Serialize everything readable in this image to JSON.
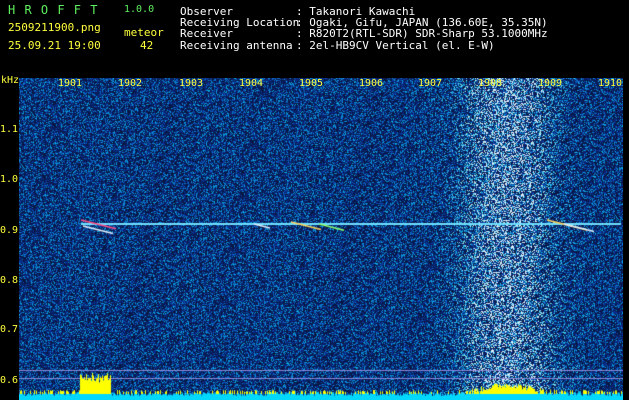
{
  "header": {
    "app_name": "H R O F F T",
    "version": "1.0.0",
    "filename": "2509211900.png",
    "datetime": "25.09.21 19:00",
    "meteor_label": "meteor",
    "meteor_count": "42",
    "info": [
      {
        "key": "Observer",
        "value": ": Takanori Kawachi"
      },
      {
        "key": "Receiving Location",
        "value": ": Ogaki, Gifu, JAPAN (136.60E, 35.35N)"
      },
      {
        "key": "Receiver",
        "value": ": R820T2(RTL-SDR) SDR-Sharp 53.1000MHz"
      },
      {
        "key": "Receiving antenna",
        "value": ": 2el-HB9CV Vertical (el. E-W)"
      }
    ]
  },
  "axes": {
    "y_unit": "kHz",
    "y_ticks": [
      "1.1",
      "1.0",
      "0.9",
      "0.8",
      "0.7",
      "0.6"
    ],
    "x_ticks": [
      "1901",
      "1902",
      "1903",
      "1904",
      "1905",
      "1906",
      "1907",
      "1908",
      "1909",
      "1910"
    ]
  },
  "colors": {
    "background": "#000000",
    "spectrogram_low": "#0a1450",
    "spectrogram_high": "#ffffff",
    "carrier_line": "#6fe0ff",
    "level_bar_low": "#00d8ff",
    "level_bar_high": "#ffff00"
  }
}
